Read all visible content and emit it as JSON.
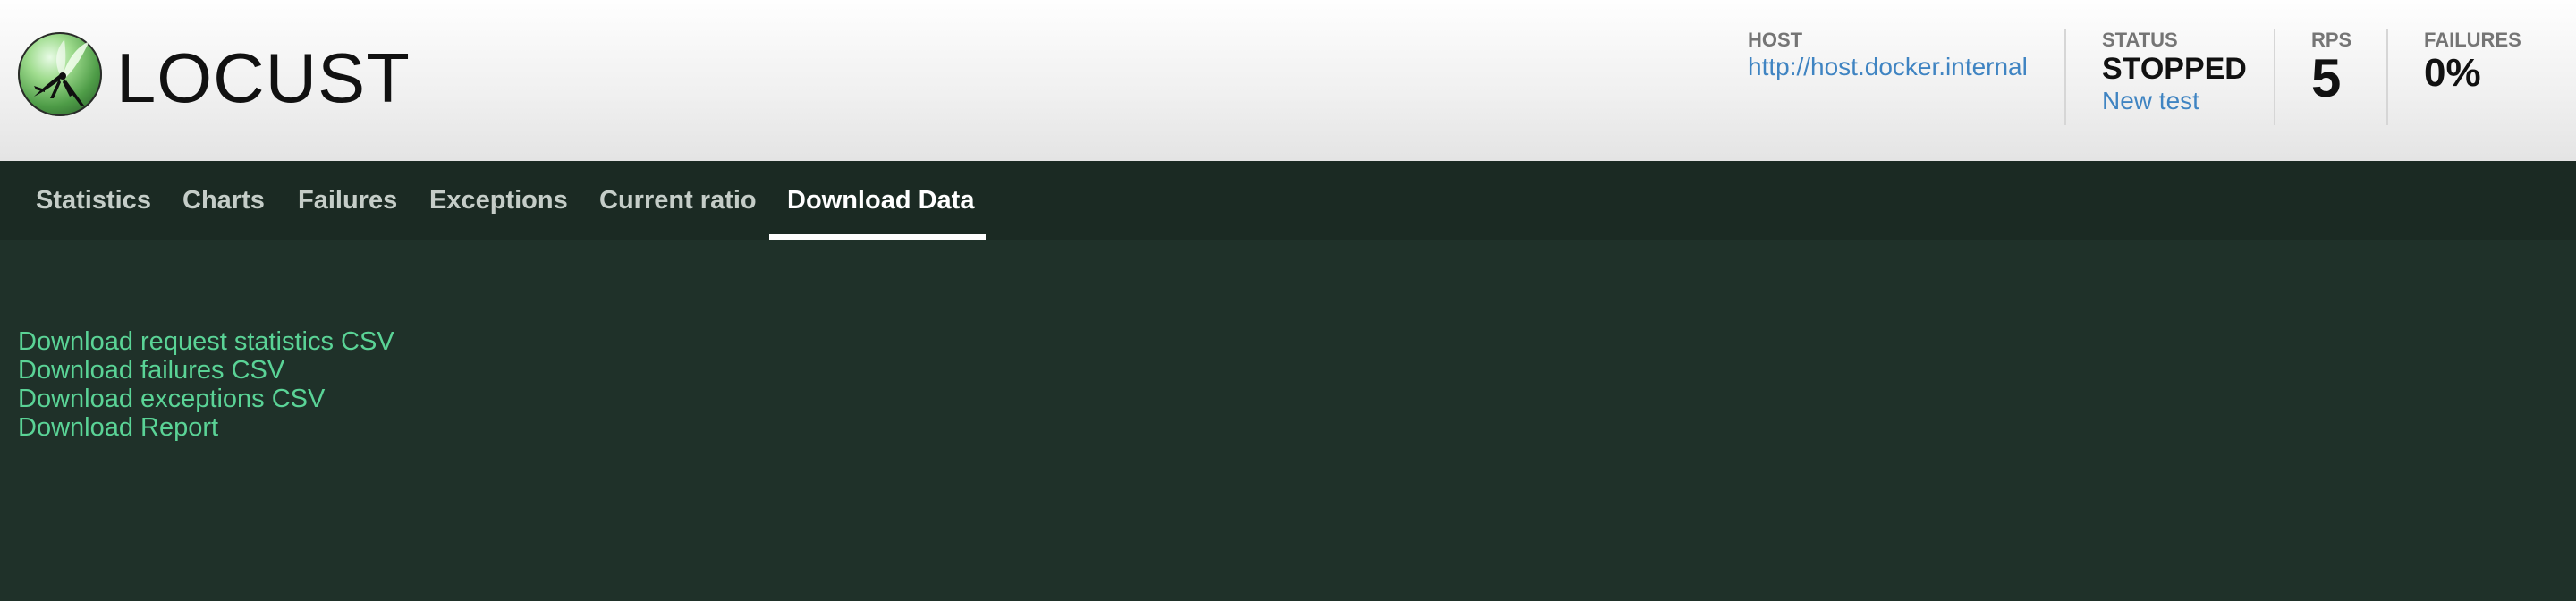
{
  "brand": {
    "name": "LOCUST",
    "logo_icon": "locust-logo-icon"
  },
  "stats": {
    "host": {
      "label": "HOST",
      "value": "http://host.docker.internal"
    },
    "status": {
      "label": "STATUS",
      "value": "STOPPED",
      "action": "New test"
    },
    "rps": {
      "label": "RPS",
      "value": "5"
    },
    "failures": {
      "label": "FAILURES",
      "value": "0%"
    }
  },
  "tabs": [
    {
      "label": "Statistics",
      "active": false
    },
    {
      "label": "Charts",
      "active": false
    },
    {
      "label": "Failures",
      "active": false
    },
    {
      "label": "Exceptions",
      "active": false
    },
    {
      "label": "Current ratio",
      "active": false
    },
    {
      "label": "Download Data",
      "active": true
    }
  ],
  "downloads": [
    {
      "label": "Download request statistics CSV"
    },
    {
      "label": "Download failures CSV"
    },
    {
      "label": "Download exceptions CSV"
    },
    {
      "label": "Download Report"
    }
  ],
  "colors": {
    "content_bg": "#1f3129",
    "nav_bg": "#1b2a23",
    "link_green": "#5ad396",
    "link_blue": "#3f84c2"
  }
}
